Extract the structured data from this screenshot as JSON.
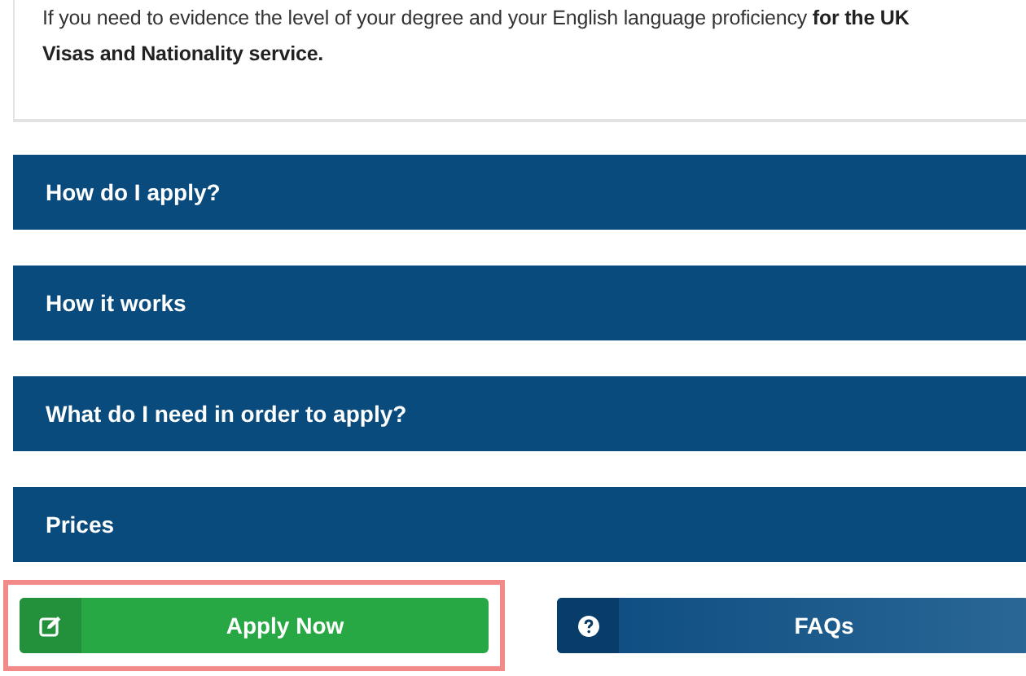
{
  "intro": {
    "lines": [
      "If you need to evidence the level of your degree and your English language proficiency **for the UK**",
      "**Visas and Nationality service.**"
    ]
  },
  "accordion": [
    {
      "label": "How do I apply?",
      "expanded": false
    },
    {
      "label": "How it works",
      "expanded": false
    },
    {
      "label": "What do I need in order to apply?",
      "expanded": false
    },
    {
      "label": "Prices",
      "expanded": false
    }
  ],
  "buttons": [
    {
      "label": "Apply Now",
      "kind": "apply",
      "focused": true
    },
    {
      "label": "FAQs",
      "kind": "faq",
      "focused": false
    }
  ]
}
